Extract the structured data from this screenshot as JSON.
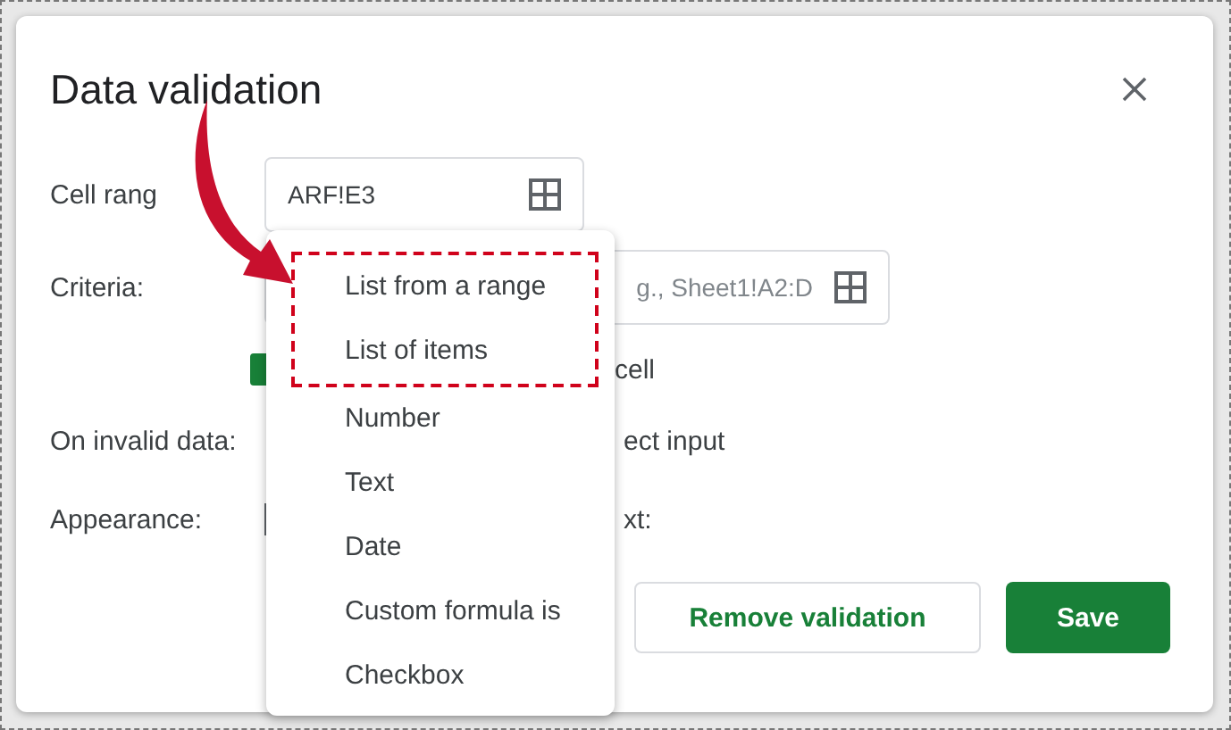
{
  "dialog": {
    "title": "Data validation",
    "cell_range": {
      "label": "Cell rang",
      "value": "ARF!E3"
    },
    "criteria": {
      "label": "Criteria:",
      "placeholder": "g., Sheet1!A2:D"
    },
    "show_dropdown": {
      "checked": true,
      "label": "cell"
    },
    "on_invalid_data": {
      "label": "On invalid data:",
      "value": "ect input"
    },
    "appearance": {
      "label": "Appearance:",
      "value": "xt:"
    },
    "buttons": [
      {
        "label": "Remove validation",
        "kind": "outline"
      },
      {
        "label": "Save",
        "kind": "primary"
      }
    ]
  },
  "criteria_menu": {
    "items": [
      {
        "label": "List from a range",
        "highlighted": true
      },
      {
        "label": "List of items",
        "highlighted": true
      },
      {
        "label": "Number",
        "highlighted": false
      },
      {
        "label": "Text",
        "highlighted": false
      },
      {
        "label": "Date",
        "highlighted": false
      },
      {
        "label": "Custom formula is",
        "highlighted": false
      },
      {
        "label": "Checkbox",
        "highlighted": false
      }
    ]
  }
}
